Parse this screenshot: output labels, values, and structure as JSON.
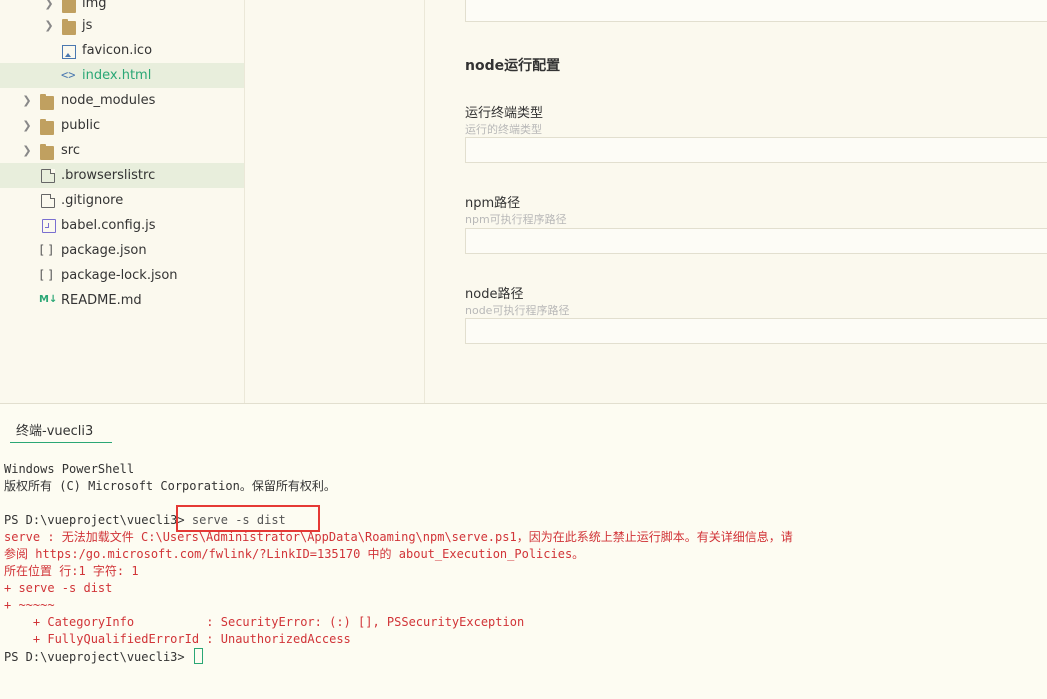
{
  "sidebar": {
    "items": [
      {
        "label": "img",
        "icon": "folder-icon",
        "expandable": true
      },
      {
        "label": "js",
        "icon": "folder-icon",
        "expandable": true
      },
      {
        "label": "favicon.ico",
        "icon": "image-file-icon",
        "expandable": false
      },
      {
        "label": "index.html",
        "icon": "code-file-icon",
        "expandable": false,
        "active": true
      },
      {
        "label": "node_modules",
        "icon": "folder-icon",
        "expandable": true
      },
      {
        "label": "public",
        "icon": "folder-icon",
        "expandable": true
      },
      {
        "label": "src",
        "icon": "folder-icon",
        "expandable": true
      },
      {
        "label": ".browserslistrc",
        "icon": "file-icon",
        "expandable": false,
        "selected": true
      },
      {
        "label": ".gitignore",
        "icon": "file-icon",
        "expandable": false
      },
      {
        "label": "babel.config.js",
        "icon": "js-file-icon",
        "expandable": false
      },
      {
        "label": "package.json",
        "icon": "json-file-icon",
        "expandable": false
      },
      {
        "label": "package-lock.json",
        "icon": "json-file-icon",
        "expandable": false
      },
      {
        "label": "README.md",
        "icon": "markdown-file-icon",
        "expandable": false
      }
    ]
  },
  "config": {
    "section_title": "node运行配置",
    "fields": [
      {
        "label": "运行终端类型",
        "hint": "运行的终端类型",
        "value": ""
      },
      {
        "label": "npm路径",
        "hint": "npm可执行程序路径",
        "value": ""
      },
      {
        "label": "node路径",
        "hint": "node可执行程序路径",
        "value": ""
      }
    ]
  },
  "terminal": {
    "tab_label": "终端-vuecli3",
    "lines": {
      "l1": "Windows PowerShell",
      "l2": "版权所有 (C) Microsoft Corporation。保留所有权利。",
      "prompt1": "PS D:\\vueproject\\vuecli3> ",
      "cmd1": "serve -s dist",
      "e1": "serve : 无法加载文件 C:\\Users\\Administrator\\AppData\\Roaming\\npm\\serve.ps1，因为在此系统上禁止运行脚本。有关详细信息，请",
      "e2": "参阅 https:/go.microsoft.com/fwlink/?LinkID=135170 中的 about_Execution_Policies。",
      "e3": "所在位置 行:1 字符: 1",
      "e4": "+ serve -s dist",
      "e5": "+ ~~~~~",
      "e6": "    + CategoryInfo          : SecurityError: (:) [], PSSecurityException",
      "e7": "    + FullyQualifiedErrorId : UnauthorizedAccess",
      "prompt2": "PS D:\\vueproject\\vuecli3> "
    }
  },
  "colors": {
    "accent": "#2aa775",
    "error": "#d13438",
    "highlight_box": "#e53935",
    "folder": "#c0a060"
  }
}
